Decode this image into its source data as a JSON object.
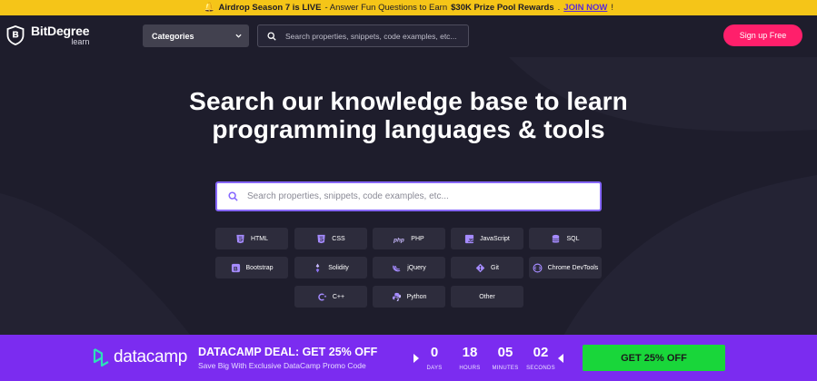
{
  "announcement": {
    "emoji": "🔔",
    "prefix": "Airdrop Season 7 is LIVE",
    "middle": " - Answer Fun Questions to Earn ",
    "highlight": "$30K Prize Pool Rewards",
    "sep": ".",
    "link": "JOIN NOW",
    "suffix": "!"
  },
  "header": {
    "logo_name": "BitDegree",
    "logo_sub": "learn",
    "categories_label": "Categories",
    "search_placeholder": "Search properties, snippets, code examples, etc...",
    "signup_label": "Sign up Free"
  },
  "hero": {
    "headline_line1": "Search our knowledge base to learn",
    "headline_line2": "programming languages & tools",
    "search_placeholder": "Search properties, snippets, code examples, etc..."
  },
  "tags": [
    {
      "label": "HTML",
      "icon": "html5-icon"
    },
    {
      "label": "CSS",
      "icon": "css3-icon"
    },
    {
      "label": "PHP",
      "icon": "php-icon"
    },
    {
      "label": "JavaScript",
      "icon": "javascript-icon"
    },
    {
      "label": "SQL",
      "icon": "database-icon"
    },
    {
      "label": "Bootstrap",
      "icon": "bootstrap-icon"
    },
    {
      "label": "Solidity",
      "icon": "solidity-icon"
    },
    {
      "label": "jQuery",
      "icon": "jquery-icon"
    },
    {
      "label": "Git",
      "icon": "git-icon"
    },
    {
      "label": "Chrome DevTools",
      "icon": "devtools-icon"
    },
    {
      "label": "C++",
      "icon": "cplusplus-icon"
    },
    {
      "label": "Python",
      "icon": "python-icon"
    },
    {
      "label": "Other",
      "icon": ""
    }
  ],
  "promo": {
    "brand": "datacamp",
    "title": "DATACAMP DEAL: GET 25% OFF",
    "subtitle": "Save Big With Exclusive DataCamp Promo Code",
    "countdown": [
      {
        "value": "0",
        "label": "DAYS"
      },
      {
        "value": "18",
        "label": "HOURS"
      },
      {
        "value": "05",
        "label": "MINUTES"
      },
      {
        "value": "02",
        "label": "SECONDS"
      }
    ],
    "cta_label": "GET 25% OFF"
  },
  "colors": {
    "background": "#1e1d2c",
    "topbar": "#f5c518",
    "signup": "#ff1f6b",
    "accent_purple": "#8667ff",
    "promo_bg": "#7b2cf0",
    "cta_green": "#19d63a"
  }
}
